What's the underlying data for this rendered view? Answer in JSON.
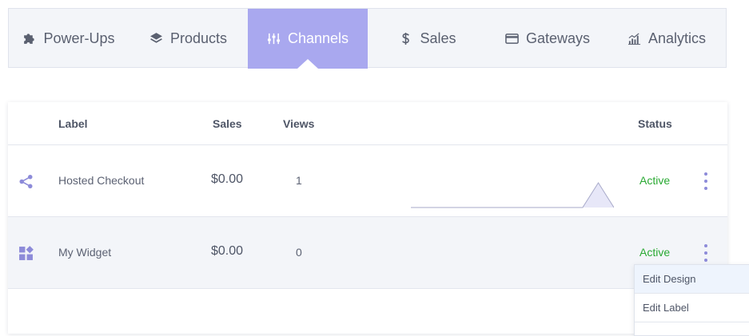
{
  "nav": {
    "items": [
      {
        "label": "Power-Ups",
        "icon": "puzzle-icon",
        "active": false
      },
      {
        "label": "Products",
        "icon": "layers-icon",
        "active": false
      },
      {
        "label": "Channels",
        "icon": "sliders-icon",
        "active": true
      },
      {
        "label": "Sales",
        "icon": "dollar-icon",
        "active": false
      },
      {
        "label": "Gateways",
        "icon": "credit-card-icon",
        "active": false
      },
      {
        "label": "Analytics",
        "icon": "bar-chart-icon",
        "active": false
      }
    ],
    "active_color": "#a9a8ef"
  },
  "table": {
    "headers": {
      "label": "Label",
      "sales": "Sales",
      "views": "Views",
      "status": "Status"
    },
    "rows": [
      {
        "label": "Hosted Checkout",
        "sales": "$0.00",
        "views": "1",
        "status": "Active",
        "icon": "share-icon",
        "sparkline": [
          0,
          0,
          0,
          0,
          0,
          0,
          0,
          0,
          0,
          0,
          0,
          0,
          1,
          0
        ]
      },
      {
        "label": "My Widget",
        "sales": "$0.00",
        "views": "0",
        "status": "Active",
        "icon": "widget-icon",
        "sparkline": []
      }
    ],
    "status_color": "#2aa933"
  },
  "menu": {
    "items": [
      {
        "label": "Edit Design",
        "highlighted": true
      },
      {
        "label": "Edit Label",
        "highlighted": false
      }
    ]
  }
}
